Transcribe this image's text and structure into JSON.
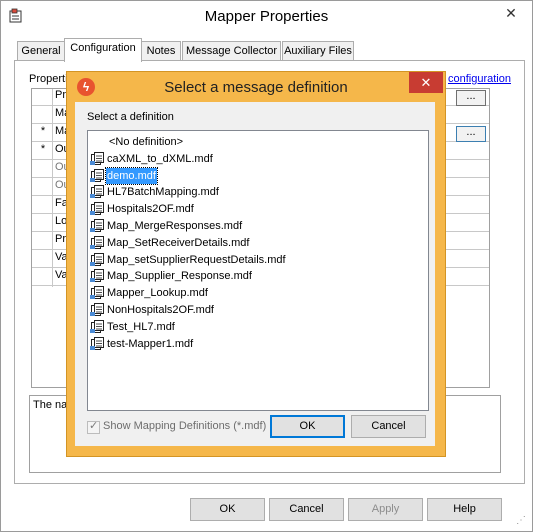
{
  "window": {
    "title": "Mapper Properties",
    "close_glyph": "✕"
  },
  "tabs": [
    {
      "label": "General"
    },
    {
      "label": "Configuration"
    },
    {
      "label": "Notes"
    },
    {
      "label": "Message Collector"
    },
    {
      "label": "Auxiliary Files"
    }
  ],
  "config": {
    "properties_label": "Properti",
    "link_text": "configuration",
    "rows": [
      {
        "star": "",
        "name": "Pro"
      },
      {
        "star": "",
        "name": "Ma"
      },
      {
        "star": "*",
        "name": "Ma"
      },
      {
        "star": "*",
        "name": "Ou"
      },
      {
        "star": "",
        "name": "Ou"
      },
      {
        "star": "",
        "name": "Ou"
      },
      {
        "star": "",
        "name": "Fa"
      },
      {
        "star": "",
        "name": "Lo"
      },
      {
        "star": "",
        "name": "Pro"
      },
      {
        "star": "",
        "name": "Va"
      },
      {
        "star": "",
        "name": "Va"
      }
    ],
    "ellipsis": "...",
    "description_text": "The nar"
  },
  "footer": {
    "ok": "OK",
    "cancel": "Cancel",
    "apply": "Apply",
    "help": "Help"
  },
  "dialog": {
    "title": "Select a message definition",
    "close_glyph": "✕",
    "subtitle": "Select a definition",
    "items": [
      {
        "label": "<No definition>",
        "icon": ""
      },
      {
        "label": "caXML_to_dXML.mdf",
        "icon": "mapping-file-icon"
      },
      {
        "label": "demo.mdf",
        "icon": "mapping-file-icon"
      },
      {
        "label": "HL7BatchMapping.mdf",
        "icon": "mapping-file-icon"
      },
      {
        "label": "Hospitals2OF.mdf",
        "icon": "mapping-file-icon"
      },
      {
        "label": "Map_MergeResponses.mdf",
        "icon": "mapping-file-icon"
      },
      {
        "label": "Map_SetReceiverDetails.mdf",
        "icon": "mapping-file-icon"
      },
      {
        "label": "Map_setSupplierRequestDetails.mdf",
        "icon": "mapping-file-icon"
      },
      {
        "label": "Map_Supplier_Response.mdf",
        "icon": "mapping-file-icon"
      },
      {
        "label": "Mapper_Lookup.mdf",
        "icon": "mapping-file-icon"
      },
      {
        "label": "NonHospitals2OF.mdf",
        "icon": "mapping-file-icon"
      },
      {
        "label": "Test_HL7.mdf",
        "icon": "mapping-file-icon"
      },
      {
        "label": "test-Mapper1.mdf",
        "icon": "mapping-file-icon"
      }
    ],
    "selected_index": 2,
    "show_mapping_label": "Show Mapping Definitions (*.mdf)",
    "show_mapping_checked": true,
    "ok": "OK",
    "cancel": "Cancel"
  },
  "colors": {
    "dialog_frame": "#f5b74a",
    "selection": "#3399ff",
    "close_red": "#c83c32"
  }
}
